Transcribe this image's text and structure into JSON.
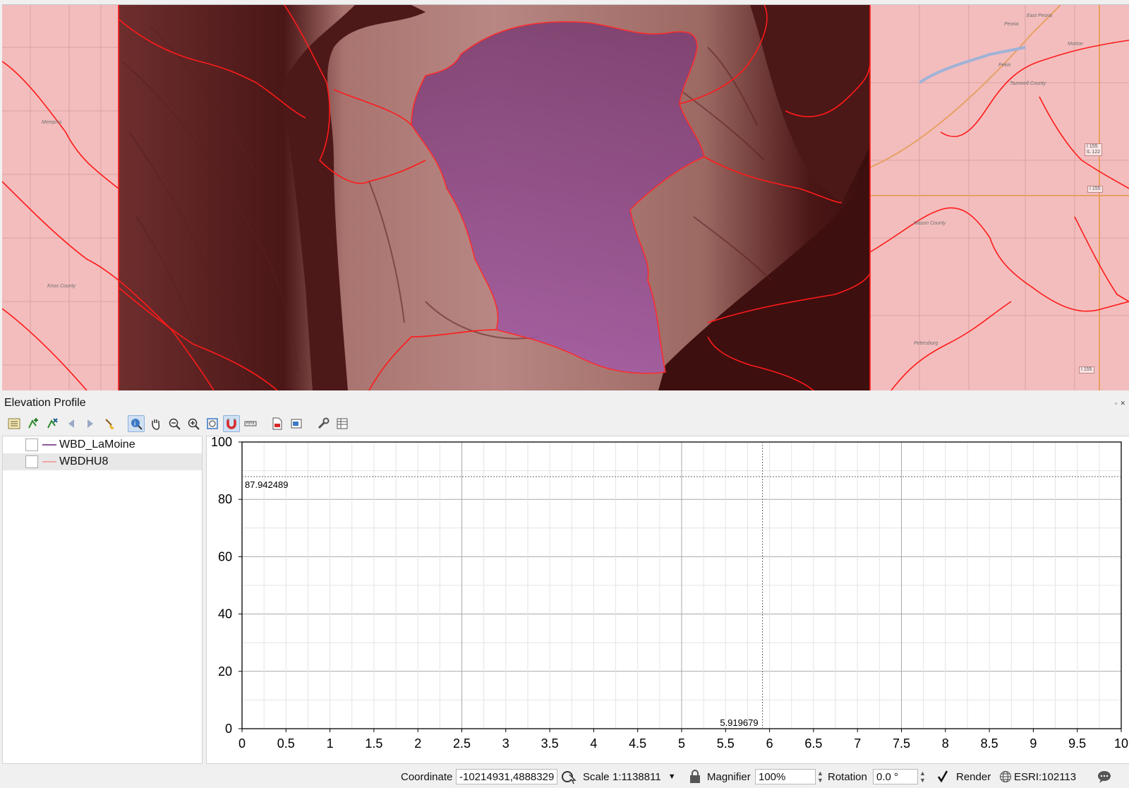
{
  "map": {
    "place_labels": {
      "memphis": "Memphis",
      "knox_county": "Knox County",
      "peoria": "Peoria",
      "east_peoria": "East Peoria",
      "morton": "Morton",
      "pekin": "Pekin",
      "tazewell_county": "Tazewell County",
      "mason_county": "Mason County",
      "petersburg": "Petersburg"
    },
    "road_labels": {
      "i155_il122": "I 155\nIL 122",
      "i155_a": "I 155",
      "i155_b": "I 155"
    },
    "colors": {
      "basemap_overlay": "#f3bdbd",
      "dem_dark": "#5a1d1d",
      "dem_light": "#c79a95",
      "watershed_fill": "#8d4a8d",
      "boundary": "#ff1a1a"
    }
  },
  "panel": {
    "title": "Elevation Profile",
    "controls": "▫ ✕"
  },
  "toolbar": {
    "buttons": [
      "layer-list-icon",
      "add-layer-icon",
      "remove-layer-icon",
      "back-arrow-icon",
      "forward-arrow-icon",
      "clear-brush-icon",
      "identify-icon",
      "pan-hand-icon",
      "zoom-out-icon",
      "zoom-in-icon",
      "zoom-extent-icon",
      "magnet-icon",
      "measure-ruler-icon",
      "export-pdf-icon",
      "export-image-icon",
      "settings-wrench-icon",
      "table-icon"
    ]
  },
  "layers": [
    {
      "name": "WBD_LaMoine",
      "color": "#8e5a99"
    },
    {
      "name": "WBDHU8",
      "color": "#f2a5a5"
    }
  ],
  "chart_data": {
    "type": "line",
    "title": "",
    "xlabel": "",
    "ylabel": "",
    "xlim": [
      0,
      10
    ],
    "ylim": [
      0,
      100
    ],
    "x_ticks": [
      "0",
      "0.5",
      "1",
      "1.5",
      "2",
      "2.5",
      "3",
      "3.5",
      "4",
      "4.5",
      "5",
      "5.5",
      "6",
      "6.5",
      "7",
      "7.5",
      "8",
      "8.5",
      "9",
      "9.5",
      "10"
    ],
    "y_ticks": [
      "0",
      "20",
      "40",
      "60",
      "80",
      "100"
    ],
    "grid": true,
    "series": [],
    "cursor": {
      "x": 5.919679,
      "y": 87.942489,
      "x_label": "5.919679",
      "y_label": "87.942489"
    }
  },
  "status": {
    "coordinate_label": "Coordinate",
    "coordinate_value": "-10214931,4888329",
    "scale_label": "Scale",
    "scale_value": "1:1138811",
    "magnifier_label": "Magnifier",
    "magnifier_value": "100%",
    "rotation_label": "Rotation",
    "rotation_value": "0.0 °",
    "render_label": "Render",
    "render_checked": true,
    "crs": "ESRI:102113"
  }
}
